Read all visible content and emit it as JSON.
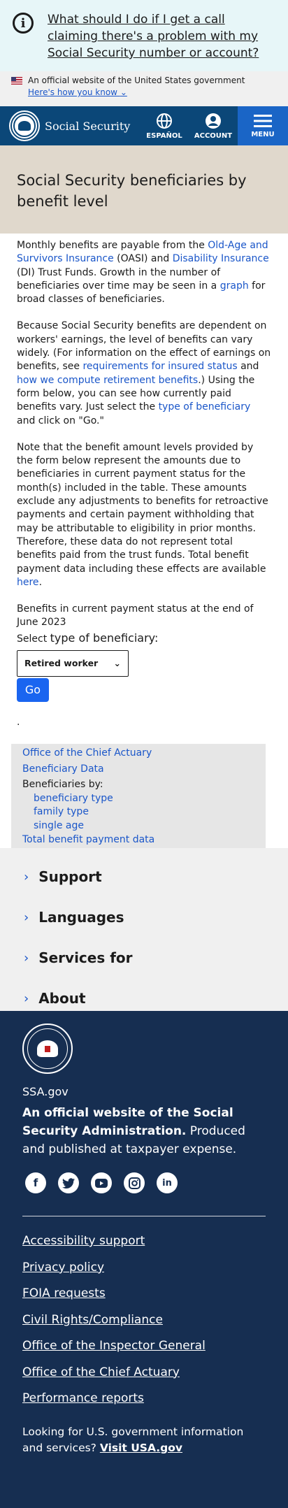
{
  "alert": {
    "text": "What should I do if I get a call claiming there's a problem with my Social Security number or account?"
  },
  "gov_banner": {
    "official": "An official website of the United States government",
    "how": "Here's how you know"
  },
  "header": {
    "brand": "Social Security",
    "espanol": "ESPAÑOL",
    "account": "ACCOUNT",
    "menu": "MENU"
  },
  "title": "Social Security beneficiaries by benefit level",
  "intro": {
    "p1_a": "Monthly benefits are payable from the ",
    "p1_link1": "Old-Age and Survivors Insurance",
    "p1_b": " (OASI) and ",
    "p1_link2": "Disability Insurance",
    "p1_c": " (DI) Trust Funds. Growth in the number of beneficiaries over time may be seen in a ",
    "p1_link3": "graph",
    "p1_d": " for broad classes of beneficiaries.",
    "p2_a": "Because Social Security benefits are dependent on workers' earnings, the level of benefits can vary widely. (For information on the effect of earnings on benefits, see ",
    "p2_link1": "requirements for insured status",
    "p2_b": " and ",
    "p2_link2": "how we compute retirement benefits",
    "p2_c": ".) Using the form below, you can see how currently paid benefits vary. Just select the ",
    "p2_link3": "type of beneficiary",
    "p2_d": " and click on \"Go.\"",
    "p3_a": "Note that the benefit amount levels provided by the form below represent the amounts due to beneficiaries in current payment status for the month(s) included in the table. These amounts exclude any adjustments to benefits for retroactive payments and certain payment withholding that may be attributable to eligibility in prior months. Therefore, these data do not represent total benefits paid from the trust funds. Total benefit payment data including these effects are available ",
    "p3_link": "here",
    "p3_b": ".",
    "p4": "Benefits in current payment status at the end of June 2023"
  },
  "form": {
    "select_prefix": "Select ",
    "select_label": "type of beneficiary:",
    "selected": "Retired worker",
    "go": "Go"
  },
  "dot": ".",
  "sidebar": {
    "actuary": "Office of the Chief Actuary",
    "bdata": "Beneficiary Data",
    "by": "Beneficiaries by:",
    "sub": [
      "beneficiary type",
      "family type",
      "single age"
    ],
    "total": "Total benefit payment data"
  },
  "accordion": [
    "Support",
    "Languages",
    "Services for",
    "About"
  ],
  "footer": {
    "ssa": "SSA.gov",
    "official_bold": "An official website of the Social Security Administration.",
    "official_rest": " Produced and published at taxpayer expense.",
    "links": [
      "Accessibility support",
      "Privacy policy",
      "FOIA requests",
      "Civil Rights/Compliance",
      "Office of the Inspector General",
      "Office of the Chief Actuary",
      "Performance reports"
    ],
    "looking": "Looking for U.S. government information and services? ",
    "usa": "Visit USA.gov"
  },
  "icons": {
    "facebook": "facebook-icon",
    "twitter": "twitter-icon",
    "youtube": "youtube-icon",
    "instagram": "instagram-icon",
    "linkedin": "linkedin-icon"
  },
  "colors": {
    "header": "#0b4778",
    "menu": "#1a65c6",
    "footer": "#162e51",
    "title_band": "#e0d8cc",
    "link": "#1a56c9",
    "go": "#1a65f0"
  }
}
